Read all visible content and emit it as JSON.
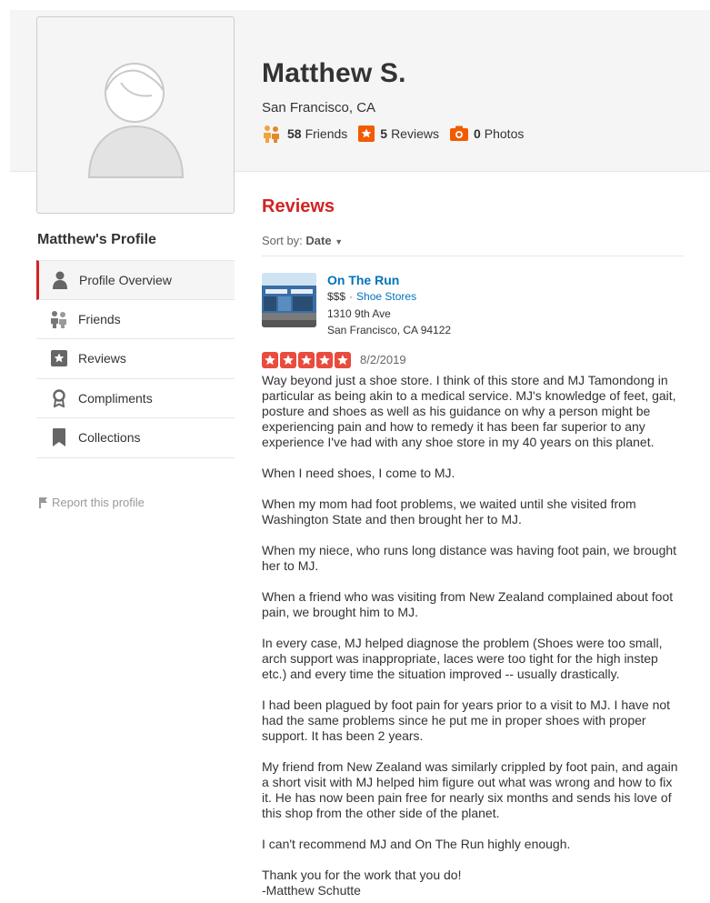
{
  "profile": {
    "name": "Matthew S.",
    "location": "San Francisco, CA",
    "stats": {
      "friends_count": "58",
      "friends_label": "Friends",
      "reviews_count": "5",
      "reviews_label": "Reviews",
      "photos_count": "0",
      "photos_label": "Photos"
    }
  },
  "sidebar": {
    "title": "Matthew's Profile",
    "items": [
      {
        "label": "Profile Overview",
        "icon": "person-icon",
        "active": true
      },
      {
        "label": "Friends",
        "icon": "friends-icon"
      },
      {
        "label": "Reviews",
        "icon": "star-box-icon"
      },
      {
        "label": "Compliments",
        "icon": "award-icon"
      },
      {
        "label": "Collections",
        "icon": "bookmark-icon"
      }
    ],
    "report_label": "Report this profile"
  },
  "reviews": {
    "title": "Reviews",
    "sort_label": "Sort by:",
    "sort_value": "Date",
    "items": [
      {
        "business": {
          "name": "On The Run",
          "price": "$$$",
          "separator": "·",
          "category": "Shoe Stores",
          "address_line1": "1310 9th Ave",
          "address_line2": "San Francisco, CA 94122"
        },
        "rating": 5,
        "date": "8/2/2019",
        "paragraphs": [
          "Way beyond just a shoe store. I think of this store and MJ Tamondong in particular as being akin to a medical service. MJ's knowledge of feet, gait, posture and shoes as well as his guidance on why a person might be experiencing pain and how to remedy it has been far superior to any experience I've had with any shoe store in my 40 years on this planet.",
          "When I need shoes, I come to MJ.",
          "When my mom had foot problems, we waited until she visited from Washington State and then brought her to MJ.",
          "When my niece, who runs long distance was having foot pain, we brought her to MJ.",
          "When a friend who was visiting from New Zealand complained about foot pain, we brought him to MJ.",
          "In every case, MJ helped diagnose the problem (Shoes were too small, arch support was inappropriate, laces were too tight for the high instep etc.) and every time the situation improved -- usually drastically.",
          "I had been plagued by foot pain for years prior to a visit to MJ. I have not had the same problems since he put me in proper shoes with proper support. It has been 2 years.",
          "My friend from New Zealand was similarly crippled by foot pain, and again a short visit with MJ helped him figure out what was wrong and how to fix it.  He has now been pain free for nearly six months and sends his love of this shop from the other side of the planet.",
          "I can't recommend MJ and On The Run highly enough.",
          "Thank you for the work that you do!",
          "-Matthew Schutte"
        ]
      }
    ]
  },
  "colors": {
    "accent_red": "#d32323",
    "link_blue": "#0073bb",
    "star_red": "#e84c3d",
    "friends_orange": "#f3a33a",
    "reviews_orange": "#f15c00",
    "photos_orange": "#f15c00"
  }
}
